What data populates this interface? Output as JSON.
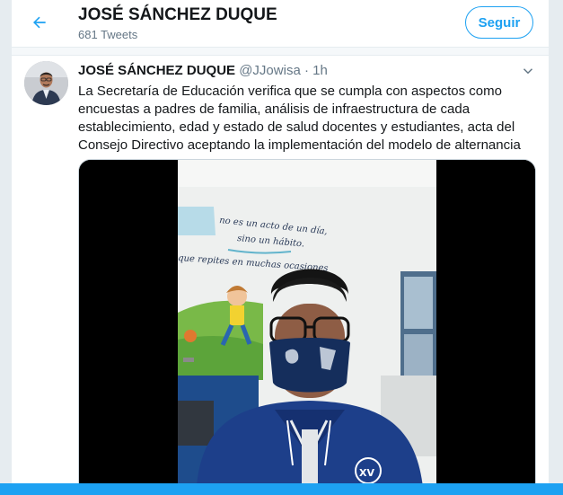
{
  "header": {
    "title": "JOSÉ SÁNCHEZ DUQUE",
    "tweet_count": "681 Tweets",
    "follow_label": "Seguir",
    "back_icon": "back-arrow-icon"
  },
  "tweet": {
    "author_name": "JOSÉ SÁNCHEZ DUQUE",
    "handle": "@JJowisa",
    "separator": "·",
    "time": "1h",
    "text": "La Secretaría de Educación verifica que se cumpla con aspectos como encuestas a padres de familia, análisis de infraestructura de cada establecimiento, edad y estado de salud docentes y estudiantes, acta del Consejo Directivo aceptando la implementación del modelo de alternancia",
    "media": {
      "type": "video",
      "wall_text": [
        "no es un acto de un día,",
        "sino un hábito.",
        "que repites en muchas ocasiones"
      ]
    }
  },
  "colors": {
    "accent": "#1da1f2",
    "text": "#14171a",
    "secondary": "#657786",
    "background": "#e6ecf0"
  }
}
